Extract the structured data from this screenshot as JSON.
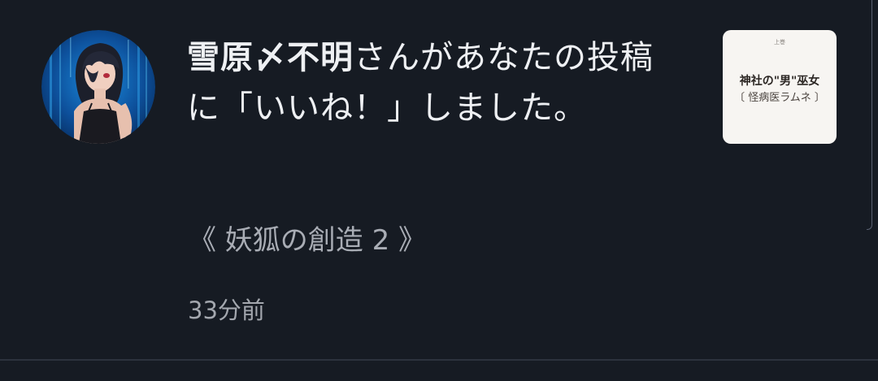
{
  "notification": {
    "username": "雪原〆不明",
    "action_text": "さんがあなたの投稿に「いいね！」しました。",
    "post_title": "《 妖狐の創造 2 》",
    "timestamp": "33分前",
    "thumbnail": {
      "top_text": "上巻",
      "line1": "神社の\"男\"巫女",
      "line2": "〔 怪病医ラムネ 〕"
    }
  },
  "colors": {
    "background": "#161b23",
    "primary_text": "#eef0f3",
    "secondary_text": "#a9adb5",
    "divider": "#2c323d"
  }
}
